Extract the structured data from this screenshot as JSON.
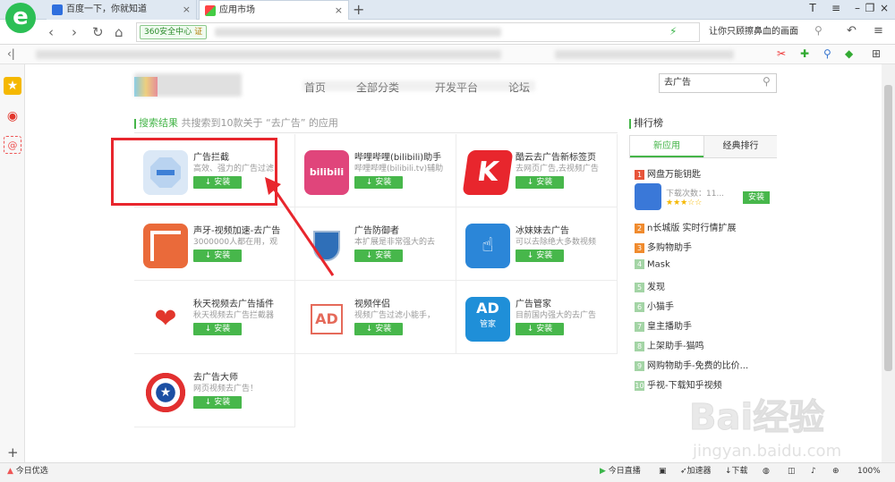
{
  "browser": {
    "tabs": [
      {
        "label": "百度一下，你就知道",
        "close": "×"
      },
      {
        "label": "应用市场",
        "close": "×"
      }
    ],
    "new_tab": "+",
    "security_label": "360安全中心",
    "security_mark": "证",
    "search_text": "让你只顾擦鼻血的画面",
    "logo_letter": "e",
    "nav": {
      "back": "‹",
      "forward": "›",
      "refresh": "↻",
      "home": "⌂"
    },
    "window": {
      "skin": "T",
      "menu": "≡",
      "minimize": "–",
      "restore": "❐",
      "close": "×"
    }
  },
  "store": {
    "nav_items": [
      "首页",
      "全部分类",
      "开发平台",
      "论坛"
    ],
    "search_value": "去广告",
    "results_title": "搜索结果",
    "results_summary": "共搜索到10款关于 “去广告” 的应用",
    "install_label": "安装",
    "apps": [
      {
        "name": "广告拦截",
        "desc": "高效、强力的广告过滤",
        "icon": "stop-sign-icon"
      },
      {
        "name": "哔哩哔哩(bilibili)助手",
        "desc": "哔哩哔哩(bilibili.tv)辅助",
        "icon": "bilibili-icon",
        "icon_text": "bilibili"
      },
      {
        "name": "酷云去广告新标签页",
        "desc": "去网页广告,去视频广告",
        "icon": "k-letter-icon",
        "icon_text": "K"
      },
      {
        "name": "声牙-视频加速-去广告",
        "desc": "3000000人都在用，观",
        "icon": "maze-icon"
      },
      {
        "name": "广告防御者",
        "desc": "本扩展是非常强大的去",
        "icon": "shield-laurel-icon"
      },
      {
        "name": "冰妹妹去广告",
        "desc": "可以去除绝大多数视频",
        "icon": "hand-click-icon"
      },
      {
        "name": "秋天视频去广告插件",
        "desc": "秋天视频去广告拦截器",
        "icon": "winged-heart-icon"
      },
      {
        "name": "视频伴侣",
        "desc": "视频广告过滤小能手，",
        "icon": "ad-blocked-icon"
      },
      {
        "name": "广告管家",
        "desc": "目前国内强大的去广告",
        "icon": "ad-manager-icon",
        "icon_text": "AD",
        "icon_sub": "管家"
      },
      {
        "name": "去广告大师",
        "desc": "网页视频去广告！",
        "icon": "captain-shield-icon"
      }
    ],
    "ranking": {
      "title": "排行榜",
      "tabs": [
        "新应用",
        "经典排行"
      ],
      "top": {
        "name": "网盘万能钥匙",
        "downloads": "下载次数：11...",
        "install": "安装"
      },
      "items": [
        {
          "num": "1",
          "label": "网盘万能钥匙"
        },
        {
          "num": "2",
          "label": "n长城版 实时行情扩展"
        },
        {
          "num": "3",
          "label": "多购物助手"
        },
        {
          "num": "4",
          "label": "Mask"
        },
        {
          "num": "5",
          "label": "发现"
        },
        {
          "num": "6",
          "label": "小猫手"
        },
        {
          "num": "7",
          "label": "皇主播助手"
        },
        {
          "num": "8",
          "label": "上架助手-猫鸣"
        },
        {
          "num": "9",
          "label": "网购物助手-免费的比价..."
        },
        {
          "num": "10",
          "label": "乎视-下载知乎视频"
        }
      ],
      "colors": {
        "top3": "#f08b2e",
        "rest": "#a3d4a5",
        "first": "#e7543a"
      }
    }
  },
  "status": {
    "left": "今日优选",
    "live": "今日直播",
    "accelerate": "加速器",
    "download": "下载",
    "zoom": "100%"
  },
  "watermark": {
    "text": "Bai经验",
    "url": "jingyan.baidu.com"
  },
  "colors": {
    "install_green": "#47b74b",
    "highlight_red": "#e8262d",
    "accent_green": "#45b549"
  }
}
